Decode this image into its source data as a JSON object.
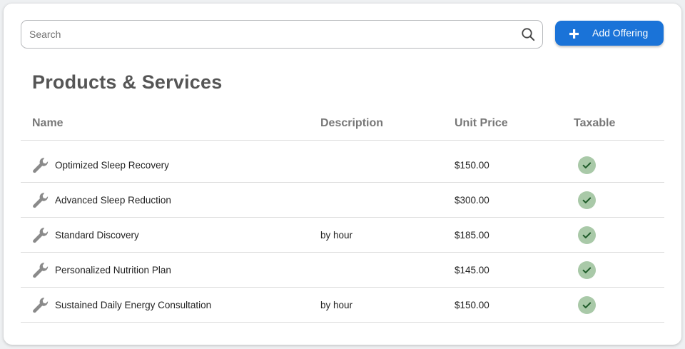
{
  "search": {
    "placeholder": "Search",
    "value": ""
  },
  "toolbar": {
    "add_label": "Add Offering"
  },
  "page": {
    "title": "Products & Services"
  },
  "table": {
    "columns": [
      "Name",
      "Description",
      "Unit Price",
      "Taxable"
    ],
    "rows": [
      {
        "name": "Optimized Sleep Recovery",
        "description": "",
        "price": "$150.00",
        "taxable": true
      },
      {
        "name": "Advanced Sleep Reduction",
        "description": "",
        "price": "$300.00",
        "taxable": true
      },
      {
        "name": "Standard Discovery",
        "description": "by hour",
        "price": "$185.00",
        "taxable": true
      },
      {
        "name": "Personalized Nutrition Plan",
        "description": "",
        "price": "$145.00",
        "taxable": true
      },
      {
        "name": "Sustained Daily Energy Consultation",
        "description": "by hour",
        "price": "$150.00",
        "taxable": true
      }
    ]
  },
  "icons": {
    "row": "wrench-icon",
    "taxable": "check-circle-icon",
    "search": "search-icon",
    "add": "plus-icon"
  },
  "colors": {
    "accent": "#1a73d8",
    "check_bg": "#a9c9a8",
    "check_mark": "#1f5c2a",
    "title": "#555555",
    "header": "#777777"
  }
}
